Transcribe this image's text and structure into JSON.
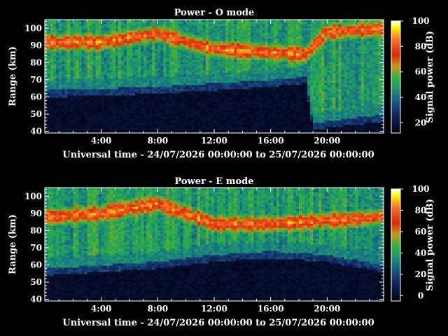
{
  "chart_data": [
    {
      "type": "heatmap",
      "title": "Power - O mode",
      "xlabel": "Universal time - 24/07/2026 00:00:00 to 25/07/2026 00:00:00",
      "ylabel": "Range (km)",
      "colorbar_label": "Signal power (dB)",
      "xlim": [
        0,
        24
      ],
      "ylim": [
        39,
        105
      ],
      "x_ticks": [
        4,
        8,
        12,
        16,
        20
      ],
      "x_tick_labels": [
        "4:00",
        "8:00",
        "12:00",
        "16:00",
        "20:00"
      ],
      "y_ticks": [
        40,
        50,
        60,
        70,
        80,
        90,
        100
      ],
      "y_tick_labels": [
        "40",
        "50",
        "60",
        "70",
        "80",
        "90",
        "100"
      ],
      "colorbar_range": [
        12,
        100
      ],
      "colorbar_ticks": [
        20,
        40,
        60,
        80,
        100
      ],
      "colorbar_tick_labels": [
        "20",
        "40",
        "60",
        "80",
        "100"
      ],
      "description_values": {
        "noise_floor_below_km": [
          [
            0,
            64
          ],
          [
            8,
            66
          ],
          [
            12,
            68
          ],
          [
            16,
            70
          ],
          [
            18.5,
            72
          ],
          [
            19,
            45
          ],
          [
            24,
            50
          ]
        ],
        "strong_layer_km": [
          [
            0,
            92
          ],
          [
            4,
            92
          ],
          [
            8,
            97
          ],
          [
            12,
            88
          ],
          [
            16,
            86
          ],
          [
            18.5,
            85
          ],
          [
            20,
            98
          ],
          [
            24,
            100
          ]
        ]
      }
    },
    {
      "type": "heatmap",
      "title": "Power - E mode",
      "xlabel": "Universal time - 24/07/2026 00:00:00 to 25/07/2026 00:00:00",
      "ylabel": "Range (km)",
      "colorbar_label": "Signal power (dB)",
      "xlim": [
        0,
        24
      ],
      "ylim": [
        39,
        105
      ],
      "x_ticks": [
        4,
        8,
        12,
        16,
        20
      ],
      "x_tick_labels": [
        "4:00",
        "8:00",
        "12:00",
        "16:00",
        "20:00"
      ],
      "y_ticks": [
        40,
        50,
        60,
        70,
        80,
        90,
        100
      ],
      "y_tick_labels": [
        "40",
        "50",
        "60",
        "70",
        "80",
        "90",
        "100"
      ],
      "colorbar_range": [
        -5,
        100
      ],
      "colorbar_ticks": [
        0,
        20,
        40,
        60,
        80,
        100
      ],
      "colorbar_tick_labels": [
        "0",
        "20",
        "40",
        "60",
        "80",
        "100"
      ],
      "description_values": {
        "noise_floor_below_km": [
          [
            0,
            58
          ],
          [
            8,
            62
          ],
          [
            12,
            66
          ],
          [
            16,
            68
          ],
          [
            20,
            66
          ],
          [
            24,
            60
          ]
        ],
        "strong_layer_km": [
          [
            0,
            88
          ],
          [
            4,
            90
          ],
          [
            8,
            96
          ],
          [
            12,
            84
          ],
          [
            16,
            84
          ],
          [
            20,
            86
          ],
          [
            24,
            88
          ]
        ]
      }
    }
  ],
  "colors": {
    "background": "#000000",
    "text": "#ffffff",
    "colormap": [
      "#000010",
      "#1a2a6a",
      "#1a6a8a",
      "#2a9a6a",
      "#3fb83f",
      "#d4a017",
      "#e03010",
      "#ff8030",
      "#ffff00",
      "#ffffff"
    ]
  }
}
